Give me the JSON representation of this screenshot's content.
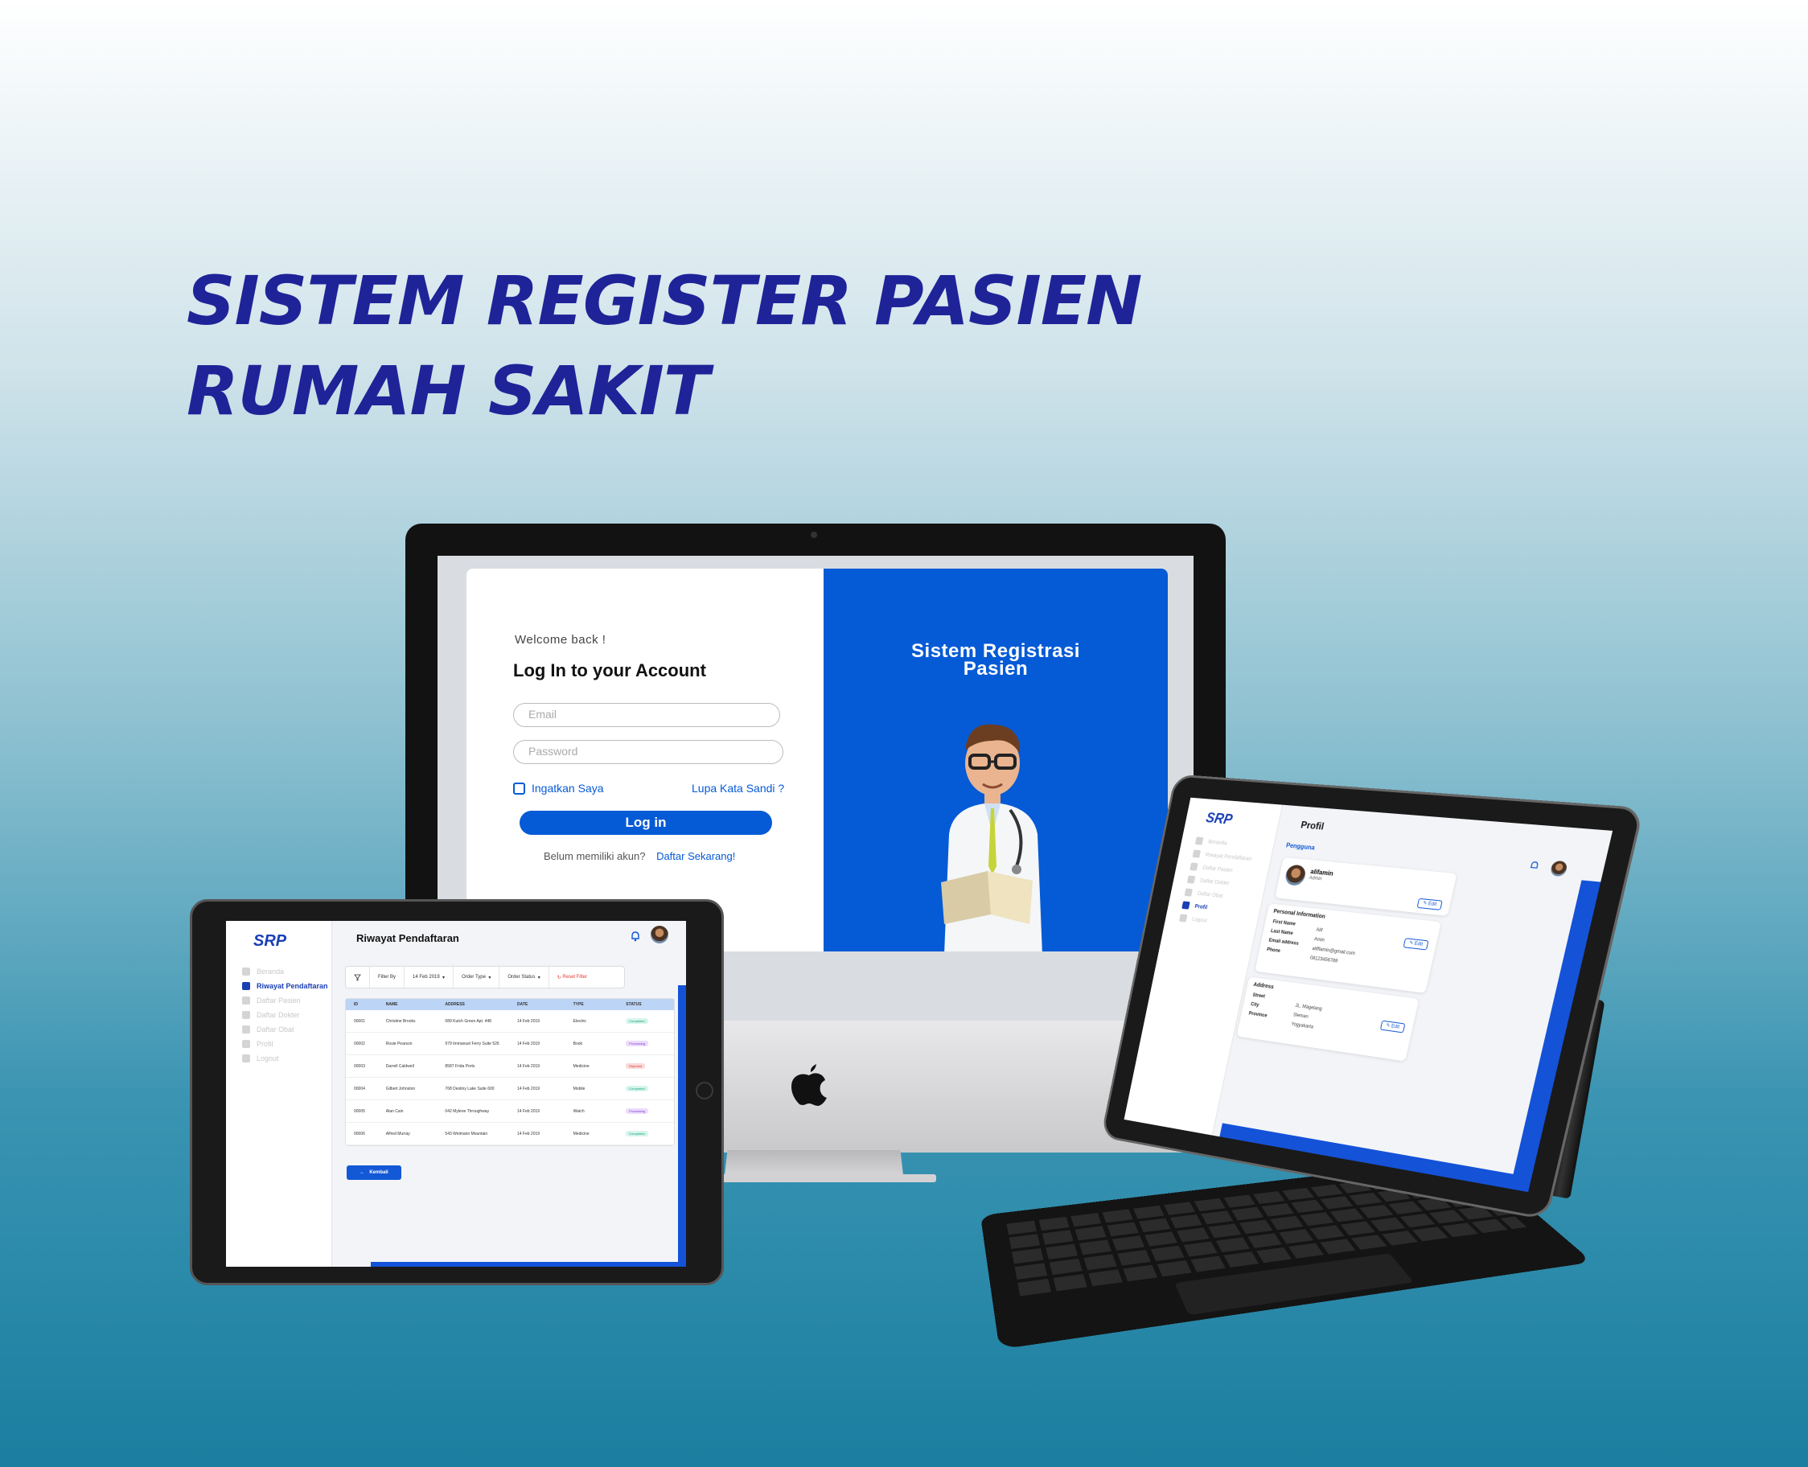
{
  "headline": {
    "line1": "SISTEM REGISTER PASIEN",
    "line2": "RUMAH SAKIT"
  },
  "imac": {
    "login": {
      "welcome": "Welcome back !",
      "title": "Log In to your Account",
      "email_placeholder": "Email",
      "password_placeholder": "Password",
      "remember": "Ingatkan Saya",
      "forgot": "Lupa Kata Sandi ?",
      "login_button": "Log in",
      "no_account": "Belum memiliki akun?",
      "register_link": "Daftar Sekarang!"
    },
    "brand_line1": "Sistem Registrasi",
    "brand_line2": "Pasien",
    "accent_color": "#055ad6"
  },
  "ipad_left": {
    "logo": "SRP",
    "page_title": "Riwayat Pendaftaran",
    "sidebar": [
      {
        "label": "Beranda",
        "icon": "home-icon",
        "active": false
      },
      {
        "label": "Riwayat Pendaftaran",
        "icon": "history-icon",
        "active": true
      },
      {
        "label": "Daftar Pasien",
        "icon": "patients-icon",
        "active": false
      },
      {
        "label": "Daftar Dokter",
        "icon": "doctor-icon",
        "active": false
      },
      {
        "label": "Daftar Obat",
        "icon": "medicine-icon",
        "active": false
      },
      {
        "label": "Profil",
        "icon": "user-icon",
        "active": false
      },
      {
        "label": "Logout",
        "icon": "logout-icon",
        "active": false
      }
    ],
    "filter": {
      "filter_by": "Filter By",
      "date": "14 Feb 2019",
      "order_type": "Order Type",
      "order_status": "Order Status",
      "reset": "Reset Filter"
    },
    "table": {
      "headers": [
        "ID",
        "NAME",
        "ADDRESS",
        "DATE",
        "TYPE",
        "STATUS"
      ],
      "rows": [
        [
          "00001",
          "Christine Brooks",
          "089 Kutch Green Apt. 448",
          "14 Feb 2019",
          "Electric",
          "Completed"
        ],
        [
          "00002",
          "Rosie Pearson",
          "979 Immanuel Ferry Suite 526",
          "14 Feb 2019",
          "Book",
          "Processing"
        ],
        [
          "00003",
          "Darrell Caldwell",
          "8587 Frida Ports",
          "14 Feb 2019",
          "Medicine",
          "Rejected"
        ],
        [
          "00004",
          "Gilbert Johnston",
          "768 Destiny Lake Suite 600",
          "14 Feb 2019",
          "Mobile",
          "Completed"
        ],
        [
          "00005",
          "Alan Cain",
          "042 Mylene Throughway",
          "14 Feb 2019",
          "Watch",
          "Processing"
        ],
        [
          "00006",
          "Alfred Murray",
          "543 Weimann Mountain",
          "14 Feb 2019",
          "Medicine",
          "Completed"
        ]
      ]
    },
    "back_button": "Kembali"
  },
  "ipad_right": {
    "logo": "SRP",
    "page_title": "Profil",
    "section": "Pengguna",
    "sidebar": [
      "Beranda",
      "Riwayat Pendaftaran",
      "Daftar Pasien",
      "Daftar Dokter",
      "Daftar Obat",
      "Profil",
      "Logout"
    ],
    "user": {
      "name": "alifamin",
      "role": "Admin"
    },
    "edit": "Edit",
    "personal_title": "Personal Information",
    "personal": [
      {
        "label": "First Name",
        "value": "Alif"
      },
      {
        "label": "Last Name",
        "value": "Amin"
      },
      {
        "label": "Email address",
        "value": "alifflamin@gmail.com"
      },
      {
        "label": "Phone",
        "value": "08123456789"
      }
    ],
    "address_title": "Address",
    "address": [
      {
        "label": "Street",
        "value": "JL. Magelang"
      },
      {
        "label": "City",
        "value": "Sleman"
      },
      {
        "label": "Province",
        "value": "Yogyakarta"
      }
    ]
  }
}
